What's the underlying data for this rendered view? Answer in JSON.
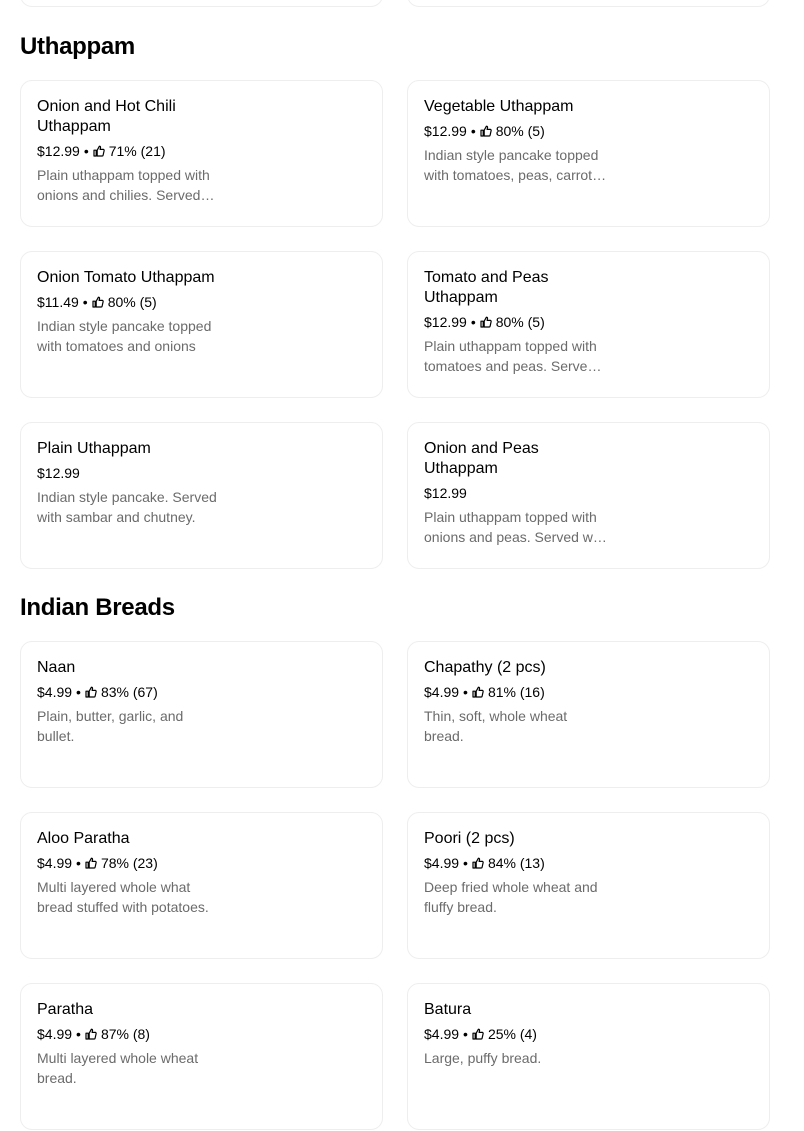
{
  "sections": [
    {
      "title": "Uthappam",
      "items": [
        {
          "name": "Onion and Hot Chili Uthappam",
          "price": "$12.99",
          "rating": "71% (21)",
          "description": "Plain uthappam topped with onions and chilies. Served with sambar and chutney."
        },
        {
          "name": "Vegetable Uthappam",
          "price": "$12.99",
          "rating": "80% (5)",
          "description": "Indian style pancake topped with tomatoes, peas, carrots and onions."
        },
        {
          "name": "Onion Tomato Uthappam",
          "price": "$11.49",
          "rating": "80% (5)",
          "description": "Indian style pancake topped with tomatoes and onions"
        },
        {
          "name": "Tomato and Peas Uthappam",
          "price": "$12.99",
          "rating": "80% (5)",
          "description": "Plain uthappam topped with tomatoes and peas. Served with sambar and chutney."
        },
        {
          "name": "Plain Uthappam",
          "price": "$12.99",
          "rating": "",
          "description": "Indian style pancake. Served with sambar and chutney."
        },
        {
          "name": "Onion and Peas Uthappam",
          "price": "$12.99",
          "rating": "",
          "description": "Plain uthappam topped with onions and peas. Served with sambar and chutney."
        }
      ]
    },
    {
      "title": "Indian Breads",
      "items": [
        {
          "name": "Naan",
          "price": "$4.99",
          "rating": "83% (67)",
          "description": "Plain, butter, garlic, and bullet."
        },
        {
          "name": "Chapathy (2 pcs)",
          "price": "$4.99",
          "rating": "81% (16)",
          "description": "Thin, soft, whole wheat bread."
        },
        {
          "name": "Aloo Paratha",
          "price": "$4.99",
          "rating": "78% (23)",
          "description": "Multi layered whole what bread stuffed with potatoes."
        },
        {
          "name": "Poori (2 pcs)",
          "price": "$4.99",
          "rating": "84% (13)",
          "description": "Deep fried whole wheat and fluffy bread."
        },
        {
          "name": "Paratha",
          "price": "$4.99",
          "rating": "87% (8)",
          "description": "Multi layered whole wheat bread."
        },
        {
          "name": "Batura",
          "price": "$4.99",
          "rating": "25% (4)",
          "description": "Large, puffy bread."
        }
      ]
    }
  ],
  "icons": {
    "rating": "thumbs-up-icon"
  },
  "separator": "•"
}
